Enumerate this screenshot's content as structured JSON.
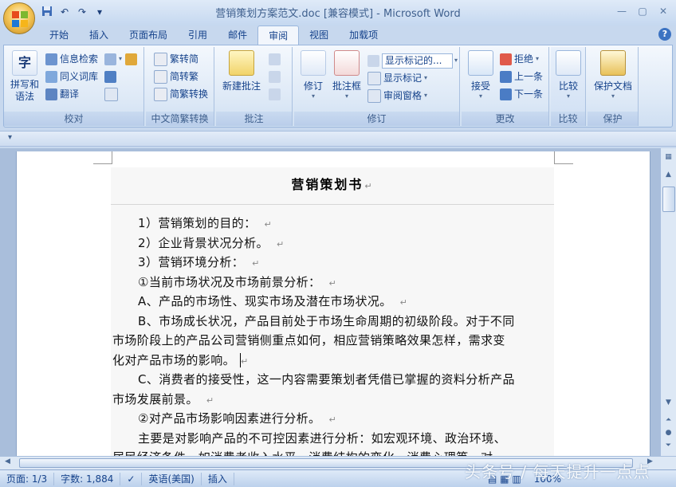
{
  "window": {
    "title": "营销策划方案范文.doc [兼容模式] - Microsoft Word",
    "controls": [
      "—",
      "▢",
      "✕"
    ]
  },
  "quick_access": [
    "save-icon",
    "undo-icon",
    "redo-icon",
    "customize-icon"
  ],
  "tabs": [
    {
      "label": "开始"
    },
    {
      "label": "插入"
    },
    {
      "label": "页面布局"
    },
    {
      "label": "引用"
    },
    {
      "label": "邮件"
    },
    {
      "label": "审阅",
      "active": true
    },
    {
      "label": "视图"
    },
    {
      "label": "加载项"
    }
  ],
  "help": "?",
  "ribbon": {
    "proofing": {
      "label": "校对",
      "spell": "拼写和\n语法",
      "research": "信息检索",
      "thesaurus": "同义词库",
      "translate": "翻译"
    },
    "chinese": {
      "label": "中文简繁转换",
      "to_traditional": "繁转简",
      "to_simplified": "简转繁",
      "convert": "简繁转换"
    },
    "comments": {
      "label": "批注",
      "new_comment": "新建批注"
    },
    "tracking": {
      "label": "修订",
      "track": "修订",
      "balloons": "批注框",
      "display_select": "显示标记的...",
      "show_markup": "显示标记",
      "review_pane": "审阅窗格"
    },
    "changes": {
      "label": "更改",
      "accept": "接受",
      "reject": "拒绝",
      "previous": "上一条",
      "next": "下一条"
    },
    "compare": {
      "label": "比较",
      "compare": "比较"
    },
    "protect": {
      "label": "保护",
      "protect_doc": "保护文档"
    }
  },
  "document": {
    "title": "营销策划书",
    "para_mark": "↵",
    "paragraphs": [
      {
        "text": "1）营销策划的目的：",
        "indent": true
      },
      {
        "text": "2）企业背景状况分析。",
        "indent": true
      },
      {
        "text": "3）营销环境分析：",
        "indent": true
      },
      {
        "text": "①当前市场状况及市场前景分析：",
        "indent": true
      },
      {
        "text": "A、产品的市场性、现实市场及潜在市场状况。",
        "indent": true
      },
      {
        "text": "B、市场成长状况，产品目前处于市场生命周期的初级阶段。对于不同",
        "indent": true
      },
      {
        "text": "市场阶段上的产品公司营销侧重点如何，相应营销策略效果怎样，需求变",
        "indent": false
      },
      {
        "text": "化对产品市场的影响。",
        "indent": false
      },
      {
        "text": "C、消费者的接受性，这一内容需要策划者凭借已掌握的资料分析产品",
        "indent": true
      },
      {
        "text": "市场发展前景。",
        "indent": false
      },
      {
        "text": "②对产品市场影响因素进行分析。",
        "indent": true
      },
      {
        "text": "主要是对影响产品的不可控因素进行分析：如宏观环境、政治环境、",
        "indent": true
      },
      {
        "text": "居民经济条件，如消费者收入水平、消费结构的变化、消费心理等，对一",
        "indent": false
      }
    ]
  },
  "status": {
    "page": "页面: 1/3",
    "words": "字数: 1,884",
    "language": "英语(美国)",
    "mode": "插入",
    "zoom": "100%"
  },
  "watermark": "头条号 / 每天提升一点点"
}
